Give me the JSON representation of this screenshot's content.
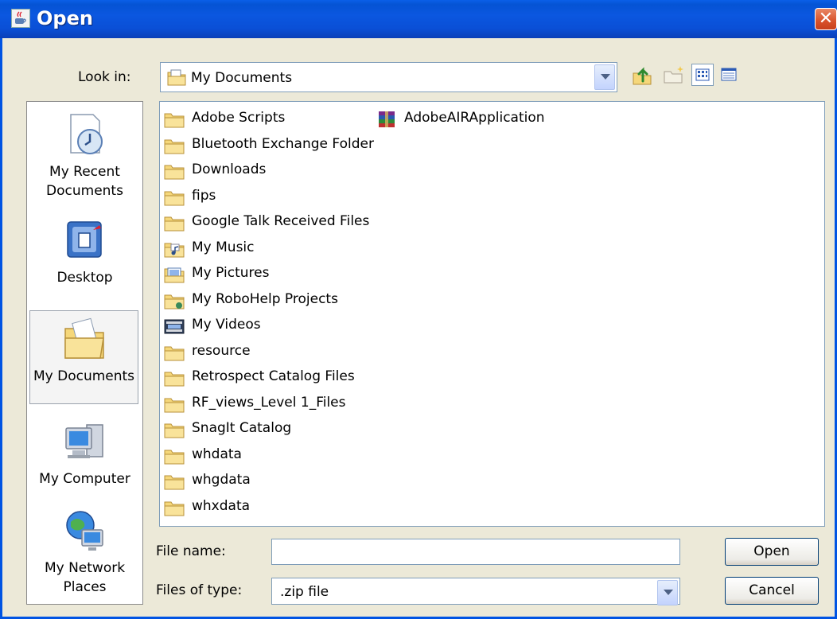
{
  "window": {
    "title": "Open",
    "close_glyph": "✕"
  },
  "lookin": {
    "label": "Look in:",
    "value": "My Documents",
    "icon": "my-documents-folder-icon"
  },
  "toolbar": {
    "buttons": [
      "up-one-level-icon",
      "create-new-folder-icon",
      "list-view-icon",
      "details-view-icon"
    ]
  },
  "places": [
    {
      "label_line1": "My Recent",
      "label_line2": "Documents",
      "icon": "recent-documents-icon",
      "selected": false
    },
    {
      "label_line1": "Desktop",
      "label_line2": "",
      "icon": "desktop-icon",
      "selected": false
    },
    {
      "label_line1": "My Documents",
      "label_line2": "",
      "icon": "my-documents-icon",
      "selected": true
    },
    {
      "label_line1": "My Computer",
      "label_line2": "",
      "icon": "my-computer-icon",
      "selected": false
    },
    {
      "label_line1": "My Network",
      "label_line2": "Places",
      "icon": "network-places-icon",
      "selected": false
    }
  ],
  "files": [
    {
      "name": "Adobe Scripts",
      "icon": "folder-icon"
    },
    {
      "name": "Bluetooth Exchange Folder",
      "icon": "folder-icon"
    },
    {
      "name": "Downloads",
      "icon": "folder-icon"
    },
    {
      "name": "fips",
      "icon": "folder-icon"
    },
    {
      "name": "Google Talk Received Files",
      "icon": "folder-icon"
    },
    {
      "name": "My Music",
      "icon": "music-folder-icon"
    },
    {
      "name": "My Pictures",
      "icon": "pictures-folder-icon"
    },
    {
      "name": "My RoboHelp Projects",
      "icon": "robohelp-folder-icon"
    },
    {
      "name": "My Videos",
      "icon": "videos-folder-icon"
    },
    {
      "name": "resource",
      "icon": "folder-icon"
    },
    {
      "name": "Retrospect Catalog Files",
      "icon": "folder-icon"
    },
    {
      "name": "RF_views_Level 1_Files",
      "icon": "folder-icon"
    },
    {
      "name": "SnagIt Catalog",
      "icon": "folder-icon"
    },
    {
      "name": "whdata",
      "icon": "folder-icon"
    },
    {
      "name": "whgdata",
      "icon": "folder-icon"
    },
    {
      "name": "whxdata",
      "icon": "folder-icon"
    },
    {
      "name": "AdobeAIRApplication",
      "icon": "archive-file-icon"
    }
  ],
  "filename": {
    "label": "File name:",
    "value": ""
  },
  "filetype": {
    "label": "Files of type:",
    "value": ".zip file"
  },
  "buttons": {
    "open": "Open",
    "cancel": "Cancel"
  },
  "colors": {
    "titlebar": "#0054e3",
    "dialog_bg": "#ece9d8",
    "close": "#d8512a",
    "folder": "#f5d77a"
  }
}
